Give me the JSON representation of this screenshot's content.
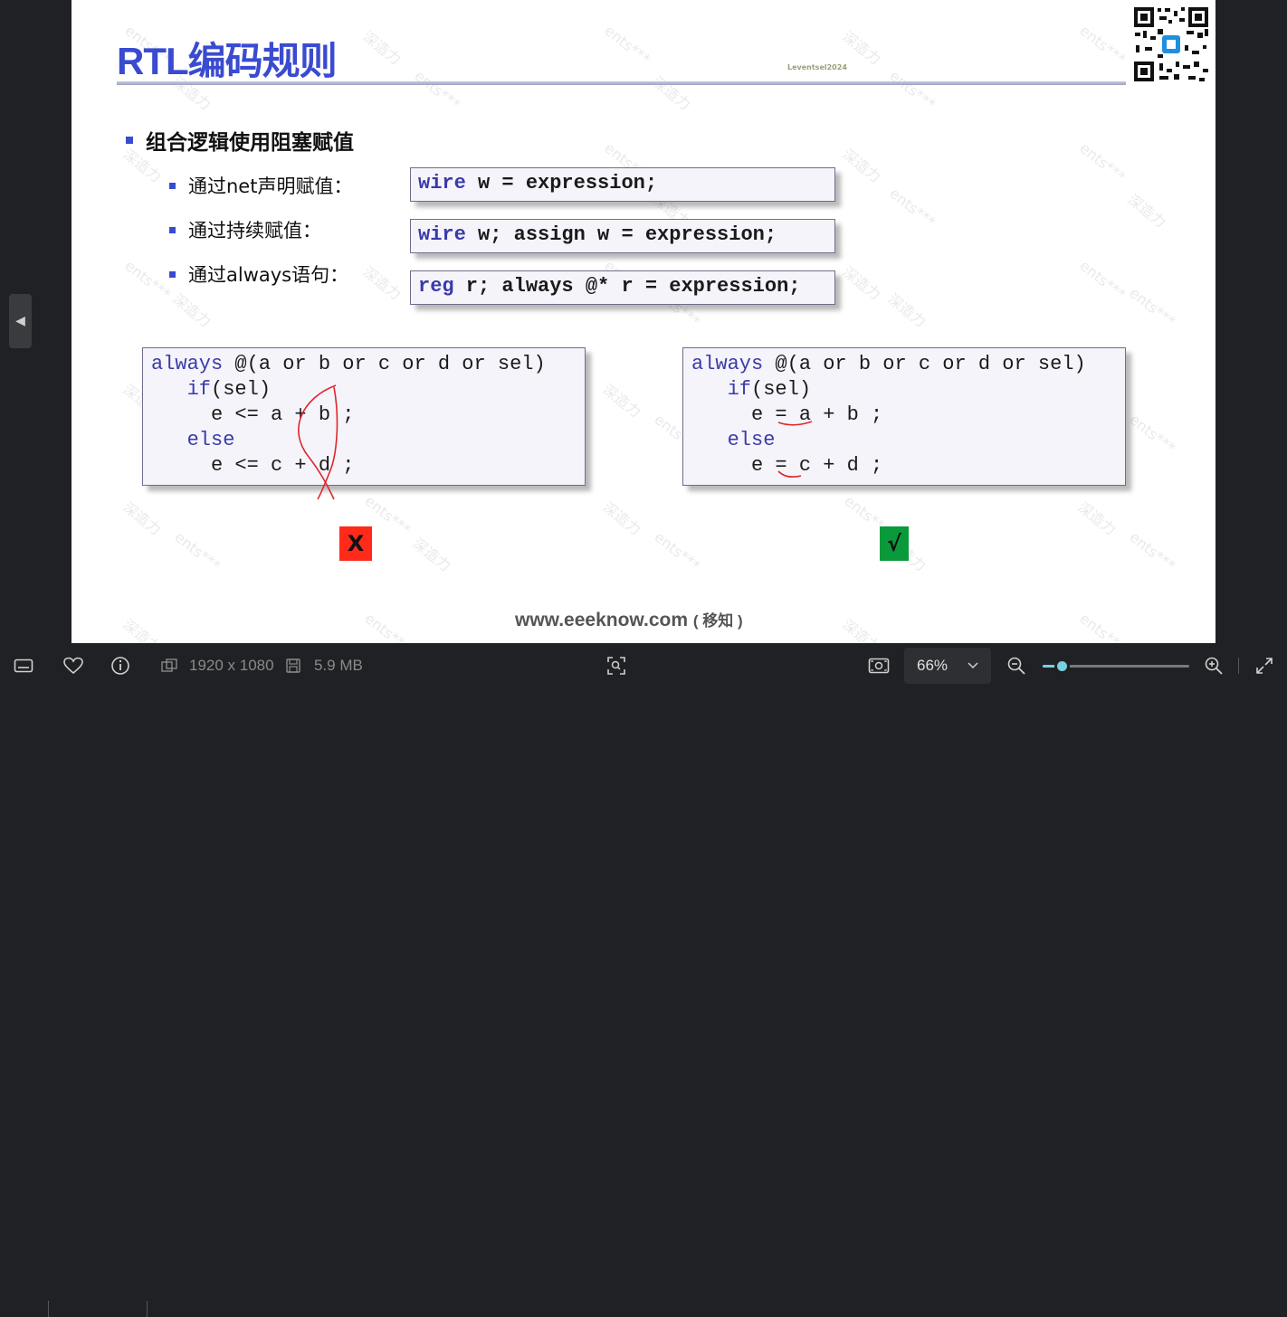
{
  "slide": {
    "title": "RTL编码规则",
    "tiny_mark": "Leventsel2024",
    "bullet_main": "组合逻辑使用阻塞赋值",
    "subs": [
      {
        "label": "通过net声明赋值："
      },
      {
        "label": "通过持续赋值："
      },
      {
        "label": "通过always语句："
      }
    ],
    "code1": {
      "kw": "wire",
      "rest": " w = expression;"
    },
    "code2": {
      "kw": "wire",
      "rest": " w; assign w = expression;"
    },
    "code3": {
      "kw": "reg",
      "rest": " r; always @* r = expression;"
    },
    "left_code": {
      "l1kw": "always",
      "l1": " @(a or b or c or d or sel)",
      "l2kw": "if",
      "l2": "(sel)",
      "l3": "e <= a + b ;",
      "l4kw": "else",
      "l5": "e <= c + d ;"
    },
    "right_code": {
      "l1kw": "always",
      "l1": " @(a or b or c or d or sel)",
      "l2kw": "if",
      "l2": "(sel)",
      "l3": "e = a + b ;",
      "l4kw": "else",
      "l5": "e = c + d ;"
    },
    "wrong_mark": "X",
    "right_mark": "√",
    "footer_url": "www.eeeknow.com",
    "footer_cn": "( 移知 )",
    "watermark_a": "ents***",
    "watermark_b": "深造力",
    "colors": {
      "title": "#3a4bd0",
      "wrong": "#ff2a1a",
      "right": "#0a9a3c",
      "annotation": "#e0262a"
    }
  },
  "toolbar": {
    "dimensions": "1920 x 1080",
    "file_size": "5.9 MB",
    "zoom_level": "66%",
    "zoom_fraction": 0.13,
    "icons": [
      "filmstrip-icon",
      "heart-icon",
      "info-icon",
      "image-size-icon",
      "save-icon",
      "scan-icon",
      "screen-icon",
      "zoom-out-icon",
      "zoom-in-icon",
      "expand-icon"
    ]
  }
}
